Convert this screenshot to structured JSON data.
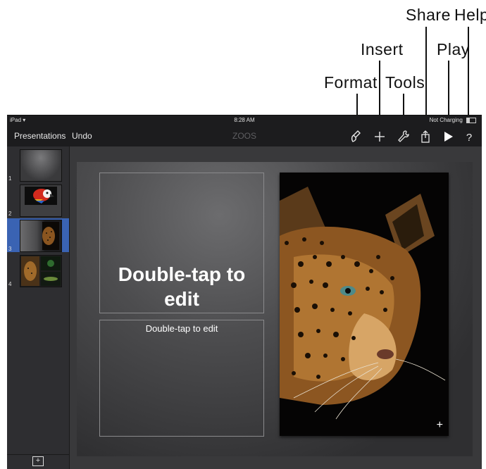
{
  "callouts": {
    "share": "Share",
    "help": "Help",
    "insert": "Insert",
    "play": "Play",
    "format": "Format",
    "tools": "Tools"
  },
  "status_bar": {
    "device": "iPad",
    "time": "8:28 AM",
    "charging": "Not Charging"
  },
  "toolbar": {
    "presentations_label": "Presentations",
    "undo_label": "Undo",
    "document_title": "ZOOS",
    "icons": [
      "format-icon",
      "insert-icon",
      "tools-icon",
      "share-icon",
      "play-icon",
      "help-icon"
    ]
  },
  "sidebar": {
    "slides": [
      {
        "number": "1"
      },
      {
        "number": "2"
      },
      {
        "number": "3",
        "selected": true
      },
      {
        "number": "4"
      }
    ],
    "add_slide_label": "+"
  },
  "slide": {
    "title_placeholder": "Double-tap to edit",
    "body_placeholder": "Double-tap to edit",
    "photo_add_label": "+"
  },
  "colors": {
    "selection": "#3a63b3",
    "toolbar_bg": "#1c1c1e",
    "canvas_bg": "#39393b"
  }
}
